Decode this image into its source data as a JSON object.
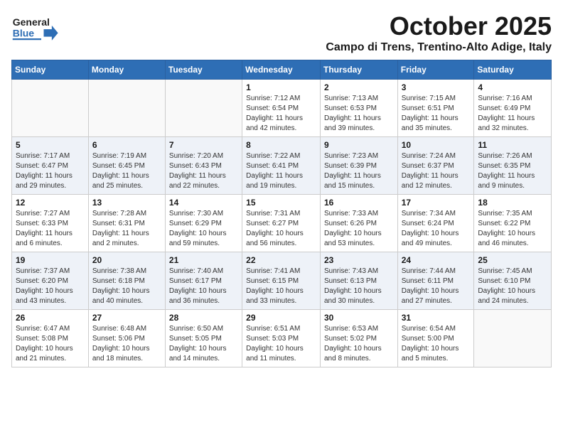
{
  "header": {
    "logo_line1": "General",
    "logo_line2": "Blue",
    "month": "October 2025",
    "location": "Campo di Trens, Trentino-Alto Adige, Italy"
  },
  "weekdays": [
    "Sunday",
    "Monday",
    "Tuesday",
    "Wednesday",
    "Thursday",
    "Friday",
    "Saturday"
  ],
  "weeks": [
    [
      {
        "day": "",
        "info": ""
      },
      {
        "day": "",
        "info": ""
      },
      {
        "day": "",
        "info": ""
      },
      {
        "day": "1",
        "info": "Sunrise: 7:12 AM\nSunset: 6:54 PM\nDaylight: 11 hours and 42 minutes."
      },
      {
        "day": "2",
        "info": "Sunrise: 7:13 AM\nSunset: 6:53 PM\nDaylight: 11 hours and 39 minutes."
      },
      {
        "day": "3",
        "info": "Sunrise: 7:15 AM\nSunset: 6:51 PM\nDaylight: 11 hours and 35 minutes."
      },
      {
        "day": "4",
        "info": "Sunrise: 7:16 AM\nSunset: 6:49 PM\nDaylight: 11 hours and 32 minutes."
      }
    ],
    [
      {
        "day": "5",
        "info": "Sunrise: 7:17 AM\nSunset: 6:47 PM\nDaylight: 11 hours and 29 minutes."
      },
      {
        "day": "6",
        "info": "Sunrise: 7:19 AM\nSunset: 6:45 PM\nDaylight: 11 hours and 25 minutes."
      },
      {
        "day": "7",
        "info": "Sunrise: 7:20 AM\nSunset: 6:43 PM\nDaylight: 11 hours and 22 minutes."
      },
      {
        "day": "8",
        "info": "Sunrise: 7:22 AM\nSunset: 6:41 PM\nDaylight: 11 hours and 19 minutes."
      },
      {
        "day": "9",
        "info": "Sunrise: 7:23 AM\nSunset: 6:39 PM\nDaylight: 11 hours and 15 minutes."
      },
      {
        "day": "10",
        "info": "Sunrise: 7:24 AM\nSunset: 6:37 PM\nDaylight: 11 hours and 12 minutes."
      },
      {
        "day": "11",
        "info": "Sunrise: 7:26 AM\nSunset: 6:35 PM\nDaylight: 11 hours and 9 minutes."
      }
    ],
    [
      {
        "day": "12",
        "info": "Sunrise: 7:27 AM\nSunset: 6:33 PM\nDaylight: 11 hours and 6 minutes."
      },
      {
        "day": "13",
        "info": "Sunrise: 7:28 AM\nSunset: 6:31 PM\nDaylight: 11 hours and 2 minutes."
      },
      {
        "day": "14",
        "info": "Sunrise: 7:30 AM\nSunset: 6:29 PM\nDaylight: 10 hours and 59 minutes."
      },
      {
        "day": "15",
        "info": "Sunrise: 7:31 AM\nSunset: 6:27 PM\nDaylight: 10 hours and 56 minutes."
      },
      {
        "day": "16",
        "info": "Sunrise: 7:33 AM\nSunset: 6:26 PM\nDaylight: 10 hours and 53 minutes."
      },
      {
        "day": "17",
        "info": "Sunrise: 7:34 AM\nSunset: 6:24 PM\nDaylight: 10 hours and 49 minutes."
      },
      {
        "day": "18",
        "info": "Sunrise: 7:35 AM\nSunset: 6:22 PM\nDaylight: 10 hours and 46 minutes."
      }
    ],
    [
      {
        "day": "19",
        "info": "Sunrise: 7:37 AM\nSunset: 6:20 PM\nDaylight: 10 hours and 43 minutes."
      },
      {
        "day": "20",
        "info": "Sunrise: 7:38 AM\nSunset: 6:18 PM\nDaylight: 10 hours and 40 minutes."
      },
      {
        "day": "21",
        "info": "Sunrise: 7:40 AM\nSunset: 6:17 PM\nDaylight: 10 hours and 36 minutes."
      },
      {
        "day": "22",
        "info": "Sunrise: 7:41 AM\nSunset: 6:15 PM\nDaylight: 10 hours and 33 minutes."
      },
      {
        "day": "23",
        "info": "Sunrise: 7:43 AM\nSunset: 6:13 PM\nDaylight: 10 hours and 30 minutes."
      },
      {
        "day": "24",
        "info": "Sunrise: 7:44 AM\nSunset: 6:11 PM\nDaylight: 10 hours and 27 minutes."
      },
      {
        "day": "25",
        "info": "Sunrise: 7:45 AM\nSunset: 6:10 PM\nDaylight: 10 hours and 24 minutes."
      }
    ],
    [
      {
        "day": "26",
        "info": "Sunrise: 6:47 AM\nSunset: 5:08 PM\nDaylight: 10 hours and 21 minutes."
      },
      {
        "day": "27",
        "info": "Sunrise: 6:48 AM\nSunset: 5:06 PM\nDaylight: 10 hours and 18 minutes."
      },
      {
        "day": "28",
        "info": "Sunrise: 6:50 AM\nSunset: 5:05 PM\nDaylight: 10 hours and 14 minutes."
      },
      {
        "day": "29",
        "info": "Sunrise: 6:51 AM\nSunset: 5:03 PM\nDaylight: 10 hours and 11 minutes."
      },
      {
        "day": "30",
        "info": "Sunrise: 6:53 AM\nSunset: 5:02 PM\nDaylight: 10 hours and 8 minutes."
      },
      {
        "day": "31",
        "info": "Sunrise: 6:54 AM\nSunset: 5:00 PM\nDaylight: 10 hours and 5 minutes."
      },
      {
        "day": "",
        "info": ""
      }
    ]
  ]
}
